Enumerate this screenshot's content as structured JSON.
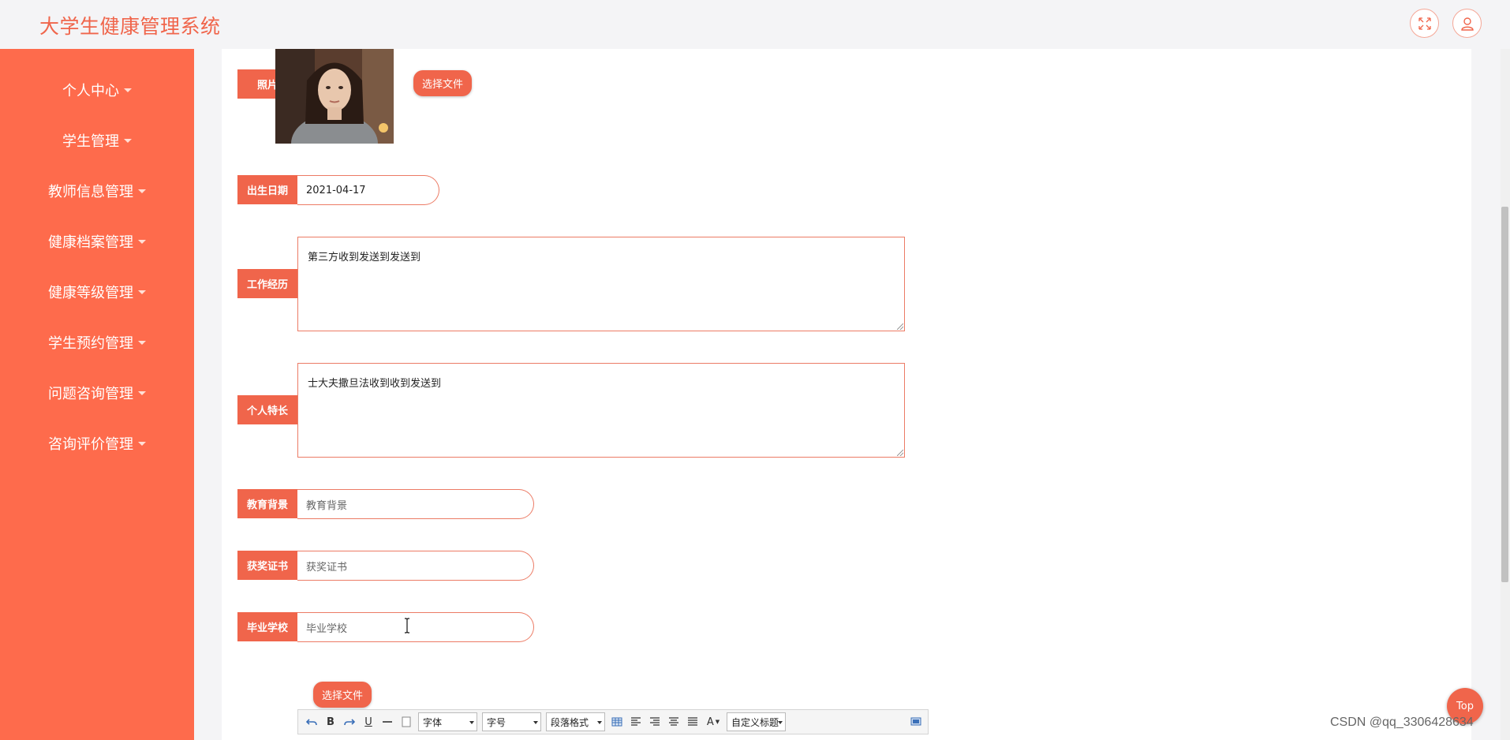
{
  "header": {
    "title": "大学生健康管理系统",
    "fullscreen_icon": "expand-icon",
    "user_icon": "user-icon"
  },
  "sidebar": {
    "items": [
      {
        "label": "个人中心"
      },
      {
        "label": "学生管理"
      },
      {
        "label": "教师信息管理"
      },
      {
        "label": "健康档案管理"
      },
      {
        "label": "健康等级管理"
      },
      {
        "label": "学生预约管理"
      },
      {
        "label": "问题咨询管理"
      },
      {
        "label": "咨询评价管理"
      }
    ]
  },
  "form": {
    "photo": {
      "label": "照片",
      "button": "选择文件"
    },
    "birthdate": {
      "label": "出生日期",
      "value": "2021-04-17"
    },
    "work_experience": {
      "label": "工作经历",
      "value": "第三方收到发送到发送到"
    },
    "specialty": {
      "label": "个人特长",
      "value": "士大夫撒旦法收到收到发送到"
    },
    "education": {
      "label": "教育背景",
      "placeholder": "教育背景"
    },
    "awards": {
      "label": "获奖证书",
      "placeholder": "获奖证书"
    },
    "school": {
      "label": "毕业学校",
      "placeholder": "毕业学校"
    },
    "file_button": "选择文件"
  },
  "editor_toolbar": {
    "bold": "B",
    "underline": "U",
    "font_family": "字体",
    "font_size": "字号",
    "paragraph": "段落格式",
    "font_color": "A",
    "custom_title": "自定义标题"
  },
  "top_button": "Top",
  "watermark": "CSDN @qq_3306428634",
  "colors": {
    "accent": "#f0654b",
    "sidebar": "#fe6b4c",
    "background": "#f4f4f6"
  }
}
